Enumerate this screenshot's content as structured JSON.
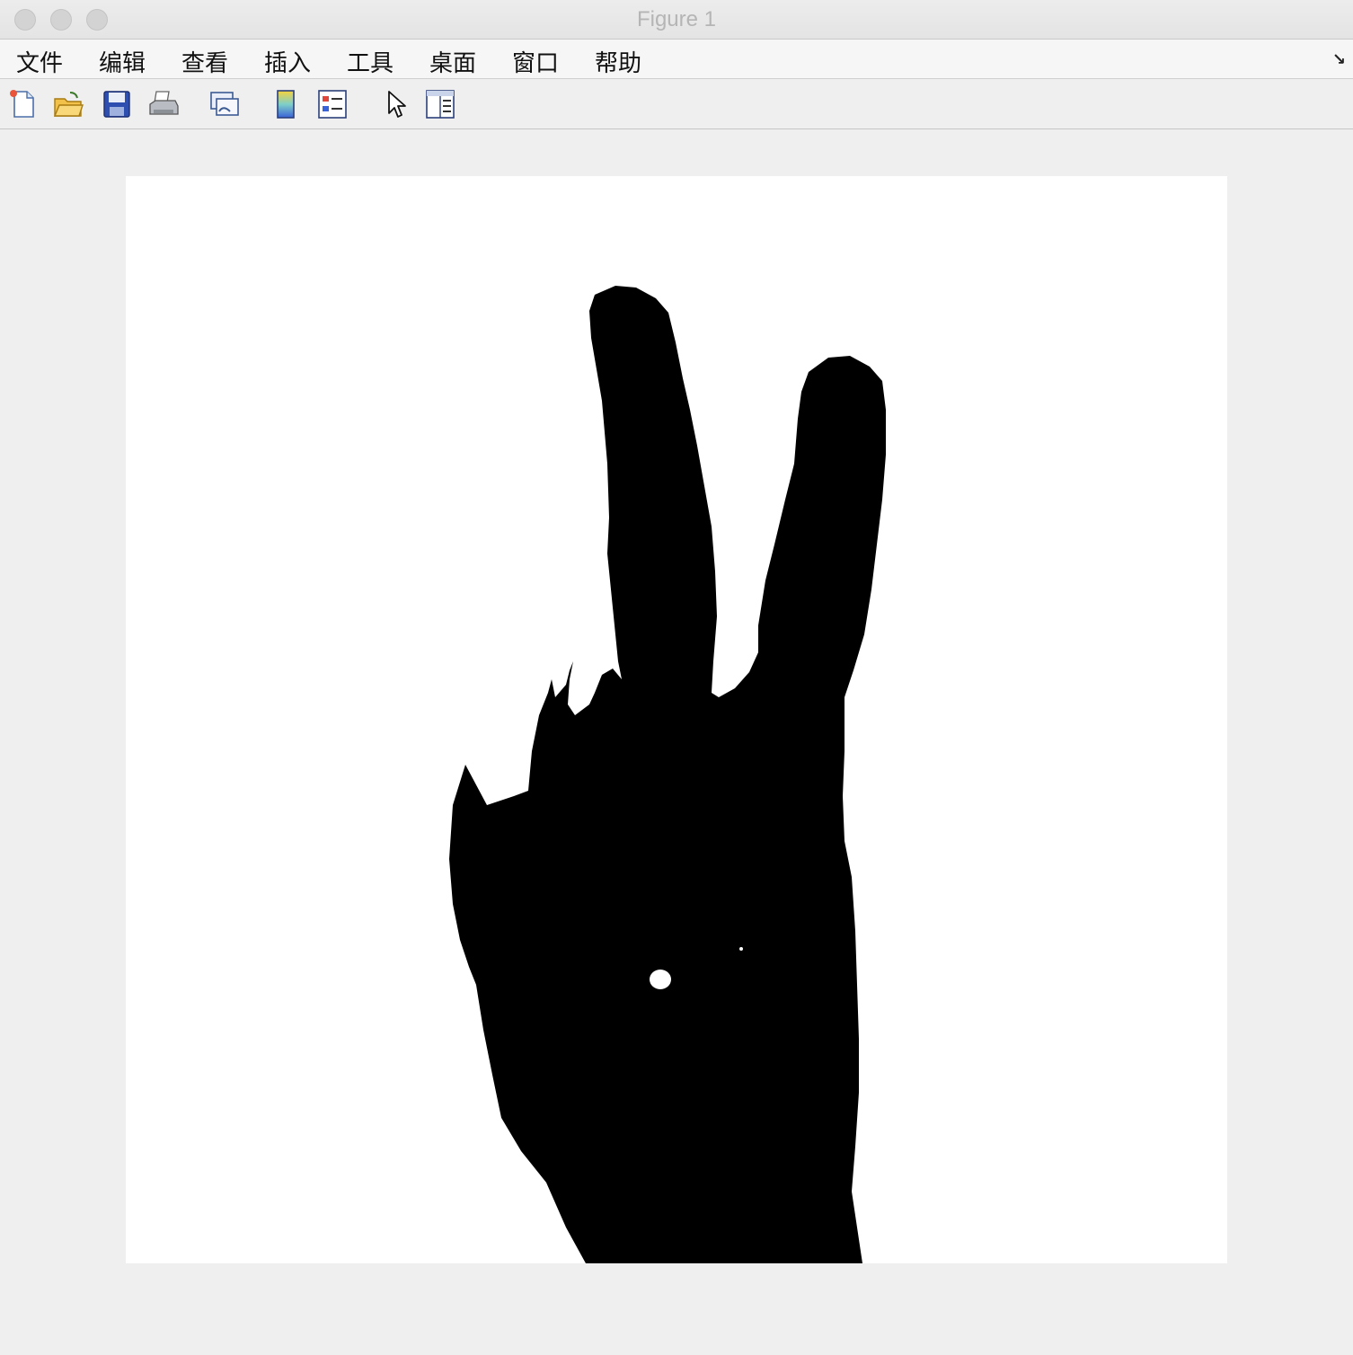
{
  "window": {
    "title": "Figure 1"
  },
  "menu": {
    "items": [
      {
        "label": "文件"
      },
      {
        "label": "编辑"
      },
      {
        "label": "查看"
      },
      {
        "label": "插入"
      },
      {
        "label": "工具"
      },
      {
        "label": "桌面"
      },
      {
        "label": "窗口"
      },
      {
        "label": "帮助"
      }
    ],
    "dock_glyph": "↘"
  },
  "toolbar": {
    "buttons": [
      {
        "icon": "new-figure-icon"
      },
      {
        "icon": "open-file-icon"
      },
      {
        "icon": "save-icon"
      },
      {
        "icon": "print-icon"
      },
      {
        "icon": "link-plot-icon"
      },
      {
        "icon": "colorbar-icon"
      },
      {
        "icon": "legend-icon"
      },
      {
        "icon": "pointer-icon"
      },
      {
        "icon": "property-editor-icon"
      }
    ]
  },
  "figure": {
    "content": "binary image of a hand making a V sign",
    "foreground_color": "#000000",
    "background_color": "#ffffff"
  }
}
